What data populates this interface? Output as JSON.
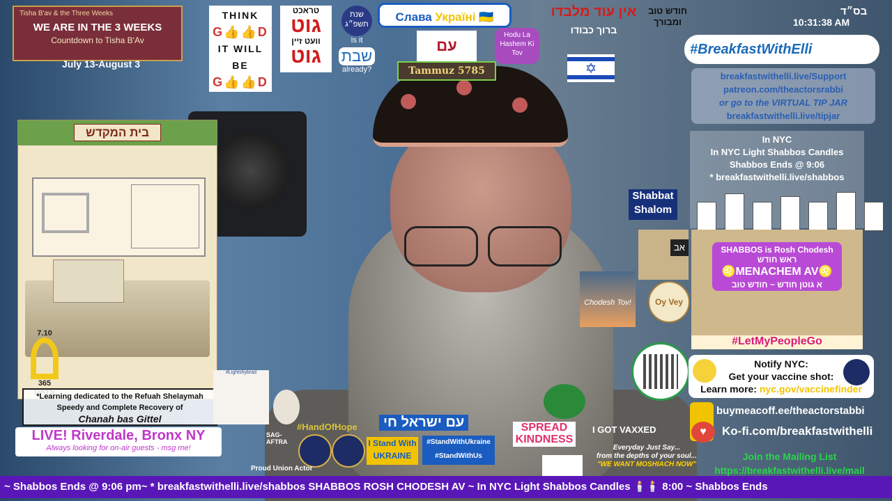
{
  "three_weeks": {
    "subtitle": "Tisha B'av & the Three Weeks",
    "title": "WE ARE IN THE 3 WEEKS",
    "countdown": "Countdown to Tisha B'Av",
    "dates": "July 13-August 3"
  },
  "think_good": {
    "think": "THINK",
    "good": "G👍👍D",
    "will_be": "IT WILL BE",
    "good2": "G👍👍D",
    "trakht": "טראכט",
    "gut": "גוט",
    "vet_zayn": "וועט זיין",
    "gut2": "גוט"
  },
  "shabbat_badge": {
    "year": "שנת תשפ״ג",
    "is_it": "Is it",
    "shabbat": "שבת",
    "already": "already?"
  },
  "slava": {
    "text": "Слава ",
    "ukraini": "Україні",
    "flag": "🇺🇦"
  },
  "hebrew_flag": "עם",
  "tammuz": "Tammuz 5785",
  "hodu": "Hodu La Hashem Ki Tov",
  "ein_od": {
    "main": "אין עוד מלבדו",
    "sub": "ברוך כבודו"
  },
  "chodesh_tov_top": "חודש טוב ומבורך",
  "israel_flag_star": "✡",
  "header": {
    "bsd": "בס״ד",
    "clock": "10:31:38 AM",
    "brand": "#BreakfastWithElli"
  },
  "support": {
    "line1": "breakfastwithelli.live/Support",
    "line2": "patreon.com/theactorsrabbi",
    "line3": "or go to the VIRTUAL TIP JAR",
    "line4": "breakfastwithelli.live/tipjar"
  },
  "nyc_times": {
    "line1": "In NYC",
    "line2": "In NYC Light Shabbos Candles",
    "line3": "Shabbos Ends @ 9:06",
    "line4": "* breakfastwithelli.live/shabbos"
  },
  "shabbat_shalom": "Shabbat Shalom",
  "rosh_chodesh": {
    "line1": "SHABBOS is Rosh Chodesh",
    "line2": "ראש חודש",
    "month": "♌MENACHEM AV♌",
    "line4": "א גוטן חודש ~ חודש טוב",
    "tag": "#LetMyPeopleGo"
  },
  "av": "אב",
  "oy_vey": "Oy Vey",
  "chodesh_tov": "Chodesh Tov!",
  "temple": {
    "title": "בית המקדש",
    "ribbon_date": "7.10",
    "ribbon_days": "365 DAYS"
  },
  "refuah": {
    "line1": "*Learning dedicated to the Refuah Shelaymah",
    "line2": "Speedy and Complete Recovery of",
    "name": "Chanah bas Gittel"
  },
  "live": {
    "title": "LIVE! Riverdale, Bronx NY",
    "subtitle": "Always looking for on-air guests - msg me!"
  },
  "bottom_badges": {
    "leaflet": "#Lightshybrad",
    "hand_of_hope": "#HandOfHope",
    "am_yisrael": "עם ישראל חי",
    "sag": "SAG-AFTRA",
    "proud": "Proud Union Actor",
    "stand_ukraine_1": "I Stand With",
    "stand_ukraine_2": "UKRAINE",
    "stand_with_1": "#StandWithUkraine",
    "stand_with_2": "#StandWithUs",
    "spread": "SPREAD KINDNESS",
    "vaxxed": "I GOT VAXXED",
    "moshiach_1": "Everyday Just Say...",
    "moshiach_2": "from the depths of your soul...",
    "moshiach_3": "\"WE WANT MOSHIACH NOW\""
  },
  "notify": {
    "line1": "Notify NYC:",
    "line2": "Get your vaccine shot:",
    "learn": "Learn more: ",
    "link": "nyc.gov/vaccinefinder"
  },
  "coffee": "buymeacoff.ee/theactorstabbi",
  "kofi": "Ko-fi.com/breakfastwithelli",
  "mailing": {
    "line1": "Join the Mailing List",
    "line2": "https://breakfastwithelli.live/mail"
  },
  "ticker": "~ Shabbos Ends @ 9:06 pm~ * breakfastwithelli.live/shabbos SHABBOS ROSH CHODESH AV ~ In NYC Light Shabbos Candles 🕯️🕯️ 8:00 ~ Shabbos Ends"
}
